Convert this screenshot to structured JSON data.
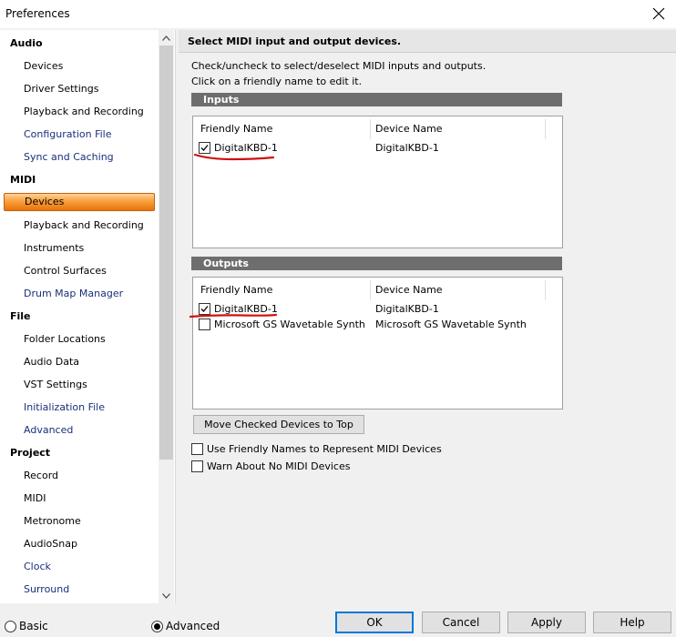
{
  "window": {
    "title": "Preferences"
  },
  "sidebar": {
    "groups": [
      {
        "label": "Audio",
        "items": [
          {
            "label": "Devices",
            "link": false
          },
          {
            "label": "Driver Settings",
            "link": false
          },
          {
            "label": "Playback and Recording",
            "link": false
          },
          {
            "label": "Configuration File",
            "link": true
          },
          {
            "label": "Sync and Caching",
            "link": true
          }
        ]
      },
      {
        "label": "MIDI",
        "items": [
          {
            "label": "Devices",
            "link": false,
            "selected": true
          },
          {
            "label": "Playback and Recording",
            "link": false
          },
          {
            "label": "Instruments",
            "link": false
          },
          {
            "label": "Control Surfaces",
            "link": false
          },
          {
            "label": "Drum Map Manager",
            "link": true
          }
        ]
      },
      {
        "label": "File",
        "items": [
          {
            "label": "Folder Locations",
            "link": false
          },
          {
            "label": "Audio Data",
            "link": false
          },
          {
            "label": "VST Settings",
            "link": false
          },
          {
            "label": "Initialization File",
            "link": true
          },
          {
            "label": "Advanced",
            "link": true
          }
        ]
      },
      {
        "label": "Project",
        "items": [
          {
            "label": "Record",
            "link": false
          },
          {
            "label": "MIDI",
            "link": false
          },
          {
            "label": "Metronome",
            "link": false
          },
          {
            "label": "AudioSnap",
            "link": false
          },
          {
            "label": "Clock",
            "link": true
          },
          {
            "label": "Surround",
            "link": true
          }
        ]
      }
    ]
  },
  "main": {
    "header": "Select MIDI input and output devices.",
    "desc1": "Check/uncheck to select/deselect MIDI inputs and outputs.",
    "desc2": "Click on a friendly name to edit it.",
    "inputs": {
      "title": "Inputs",
      "col_friendly": "Friendly Name",
      "col_device": "Device Name",
      "rows": [
        {
          "friendly": "DigitalKBD-1",
          "device": "DigitalKBD-1",
          "checked": true
        }
      ]
    },
    "outputs": {
      "title": "Outputs",
      "col_friendly": "Friendly Name",
      "col_device": "Device Name",
      "rows": [
        {
          "friendly": "DigitalKBD-1",
          "device": "DigitalKBD-1",
          "checked": true
        },
        {
          "friendly": "Microsoft GS Wavetable Synth",
          "device": "Microsoft GS Wavetable Synth",
          "checked": false
        }
      ]
    },
    "move_button": "Move Checked Devices to Top",
    "option_friendly": "Use Friendly Names to Represent MIDI Devices",
    "option_warn": "Warn About No MIDI Devices"
  },
  "footer": {
    "basic": "Basic",
    "advanced": "Advanced",
    "ok": "OK",
    "cancel": "Cancel",
    "apply": "Apply",
    "help": "Help"
  },
  "colors": {
    "selection": "#f9a03c",
    "link": "#1a2f7a",
    "section_bar": "#6e6e6e",
    "annotation": "#d01010",
    "default_button_border": "#0078d7"
  },
  "icons": [
    "close-icon",
    "scroll-up-icon",
    "scroll-down-icon",
    "checkmark-icon"
  ]
}
